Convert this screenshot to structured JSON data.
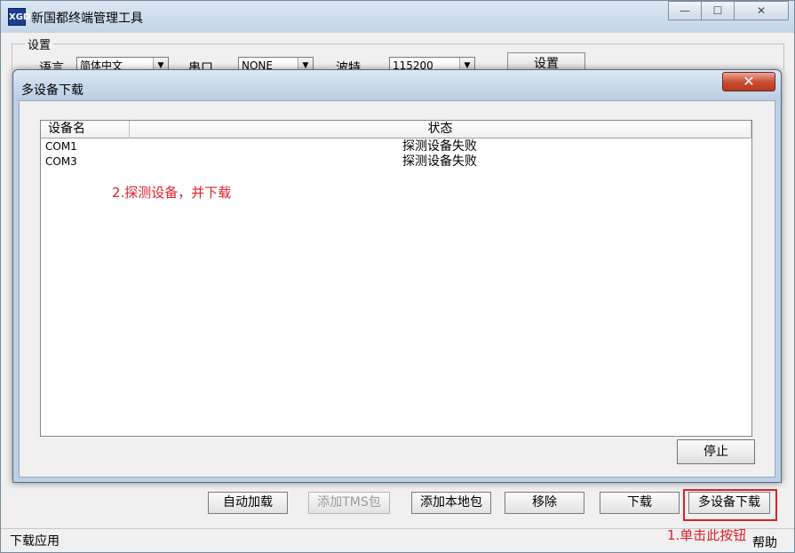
{
  "app": {
    "title": "新国都终端管理工具",
    "icon_text": "XGD"
  },
  "window_controls": {
    "minimize": "—",
    "maximize": "☐",
    "close": "✕"
  },
  "settings": {
    "legend": "设置",
    "language_label": "语言",
    "language_value": "简体中文",
    "port_label": "串口",
    "port_value": "NONE",
    "baud_label": "波特",
    "baud_value": "115200",
    "set_button": "设置"
  },
  "dialog": {
    "title": "多设备下载",
    "close_glyph": "✕",
    "columns": [
      "设备名",
      "状态"
    ],
    "rows": [
      {
        "device": "COM1",
        "status": "探测设备失败"
      },
      {
        "device": "COM3",
        "status": "探测设备失败"
      }
    ],
    "annotation": "2.探测设备，并下载",
    "stop_button": "停止"
  },
  "bottom_buttons": {
    "auto_load": "自动加载",
    "add_tms": "添加TMS包",
    "add_local": "添加本地包",
    "remove": "移除",
    "download": "下载",
    "multi_download": "多设备下载"
  },
  "annotation_bottom": "1.单击此按钮",
  "statusbar": {
    "left": "下载应用",
    "right": "帮助"
  },
  "colors": {
    "annotation_red": "#e0202a"
  }
}
